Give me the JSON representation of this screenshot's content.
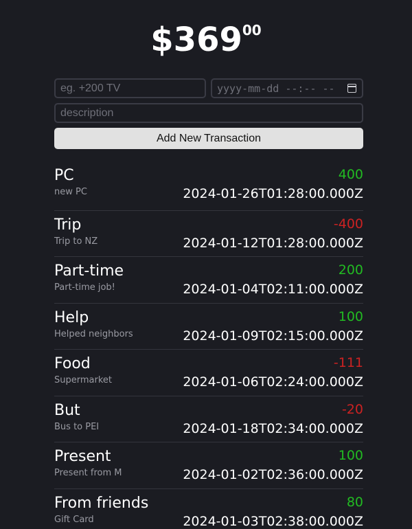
{
  "balance": {
    "main": "$369",
    "cents": "00"
  },
  "form": {
    "price_placeholder": "eg. +200 TV",
    "date_placeholder": "yyyy-mm-dd --:-- --",
    "description_placeholder": "description",
    "submit_label": "Add New Transaction"
  },
  "transactions": [
    {
      "name": "PC",
      "description": "new PC",
      "amount": "400",
      "sign": "positive",
      "datetime": "2024-01-26T01:28:00.000Z"
    },
    {
      "name": "Trip",
      "description": "Trip to NZ",
      "amount": "-400",
      "sign": "negative",
      "datetime": "2024-01-12T01:28:00.000Z"
    },
    {
      "name": "Part-time",
      "description": "Part-time job!",
      "amount": "200",
      "sign": "positive",
      "datetime": "2024-01-04T02:11:00.000Z"
    },
    {
      "name": "Help",
      "description": "Helped neighbors",
      "amount": "100",
      "sign": "positive",
      "datetime": "2024-01-09T02:15:00.000Z"
    },
    {
      "name": "Food",
      "description": "Supermarket",
      "amount": "-111",
      "sign": "negative",
      "datetime": "2024-01-06T02:24:00.000Z"
    },
    {
      "name": "But",
      "description": "Bus to PEI",
      "amount": "-20",
      "sign": "negative",
      "datetime": "2024-01-18T02:34:00.000Z"
    },
    {
      "name": "Present",
      "description": "Present from M",
      "amount": "100",
      "sign": "positive",
      "datetime": "2024-01-02T02:36:00.000Z"
    },
    {
      "name": "From friends",
      "description": "Gift Card",
      "amount": "80",
      "sign": "positive",
      "datetime": "2024-01-03T02:38:00.000Z"
    }
  ],
  "colors": {
    "background": "#1b1c22",
    "positive": "#22bb22",
    "negative": "#cc2222",
    "button": "#e1e1e1"
  },
  "icons": {
    "date_picker": "calendar-icon"
  }
}
